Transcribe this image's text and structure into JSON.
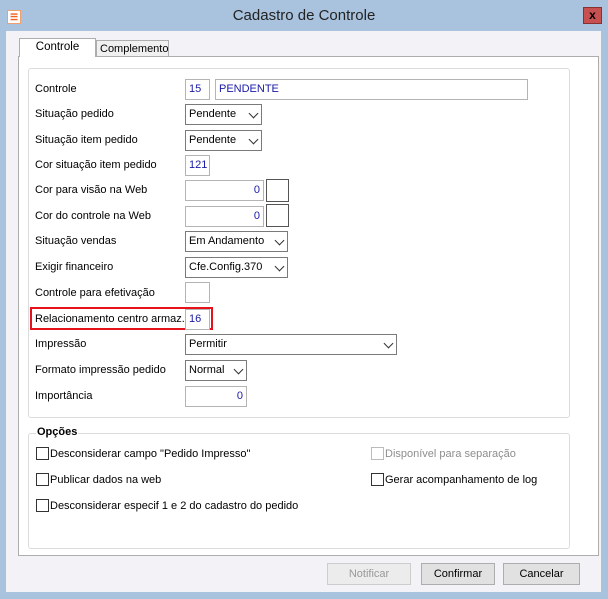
{
  "window": {
    "title": "Cadastro de Controle",
    "icon": "app-icon",
    "close_label": "x"
  },
  "tabs": [
    {
      "label": "Controle",
      "active": true
    },
    {
      "label": "Complemento",
      "active": false
    }
  ],
  "form": {
    "controle": {
      "label": "Controle",
      "code": "15",
      "name": "PENDENTE"
    },
    "situacao_pedido": {
      "label": "Situação pedido",
      "value": "Pendente"
    },
    "situacao_item_pedido": {
      "label": "Situação item pedido",
      "value": "Pendente"
    },
    "cor_situacao_item": {
      "label": "Cor situação item pedido",
      "value": "121"
    },
    "cor_visao_web": {
      "label": "Cor para visão na Web",
      "value": "0"
    },
    "cor_controle_web": {
      "label": "Cor do controle na Web",
      "value": "0"
    },
    "situacao_vendas": {
      "label": "Situação vendas",
      "value": "Em Andamento"
    },
    "exigir_financeiro": {
      "label": "Exigir financeiro",
      "value": "Cfe.Config.370"
    },
    "controle_efetivacao": {
      "label": "Controle para efetivação",
      "value": ""
    },
    "relacionamento": {
      "label": "Relacionamento centro armaz.",
      "value": "16"
    },
    "impressao": {
      "label": "Impressão",
      "value": "Permitir"
    },
    "formato_impressao": {
      "label": "Formato impressão pedido",
      "value": "Normal"
    },
    "importancia": {
      "label": "Importância",
      "value": "0"
    }
  },
  "options": {
    "title": "Opções",
    "items": [
      {
        "label": "Desconsiderar campo \"Pedido Impresso\"",
        "checked": false,
        "enabled": true
      },
      {
        "label": "Disponível para separação",
        "checked": false,
        "enabled": false
      },
      {
        "label": "Publicar dados na web",
        "checked": false,
        "enabled": true
      },
      {
        "label": "Gerar acompanhamento de log",
        "checked": false,
        "enabled": true
      },
      {
        "label": "Desconsiderar especif 1 e 2 do cadastro do pedido",
        "checked": false,
        "enabled": true
      }
    ]
  },
  "buttons": {
    "notificar": "Notificar",
    "confirmar": "Confirmar",
    "cancelar": "Cancelar"
  },
  "colors": {
    "highlight": "#e5121b",
    "value_text": "#1a1aa8"
  }
}
